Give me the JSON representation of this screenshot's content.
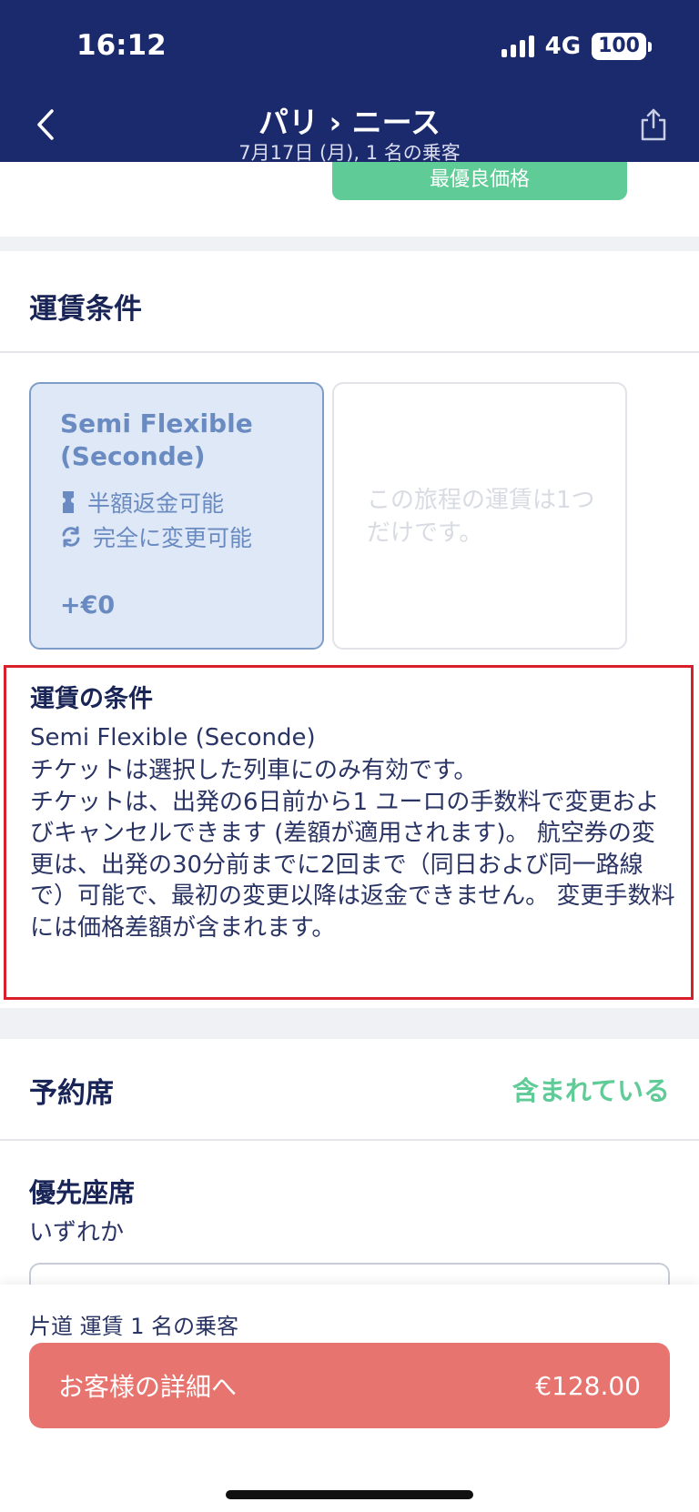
{
  "status_bar": {
    "time": "16:12",
    "network": "4G",
    "battery": "100"
  },
  "nav": {
    "title": "パリ › ニース",
    "subtitle": "7月17日 (月), 1 名の乗客"
  },
  "top_card": {
    "badge": "最優良価格"
  },
  "fare_section": {
    "title": "運賃条件",
    "selected_fare": {
      "name": "Semi Flexible (Seconde)",
      "features": [
        {
          "icon": "ticket-icon",
          "label": "半額返金可能"
        },
        {
          "icon": "exchange-icon",
          "label": "完全に変更可能"
        }
      ],
      "price": "+€0"
    },
    "empty_card_text": "この旅程の運賃は1つだけです。"
  },
  "conditions": {
    "title": "運賃の条件",
    "fare_name": "Semi Flexible (Seconde)",
    "line1": "チケットは選択した列車にのみ有効です。",
    "line2": "チケットは、出発の6日前から1 ユーロの手数料で変更およびキャンセルできます (差額が適用されます)。 航空券の変更は、出発の30分前までに2回まで（同日および同一路線で）可能で、最初の変更以降は返金できません。 変更手数料には価格差額が含まれます。"
  },
  "seat_section": {
    "title": "予約席",
    "included": "含まれている",
    "preference_title": "優先座席",
    "preference_value": "いずれか"
  },
  "bottom_bar": {
    "summary": "片道 運賃 1 名の乗客",
    "cta_label": "お客様の詳細へ",
    "cta_price": "€128.00"
  },
  "colors": {
    "navy": "#1a2a6c",
    "green": "#5fcb96",
    "cta": "#e7746e",
    "highlight": "#d81f2a"
  }
}
